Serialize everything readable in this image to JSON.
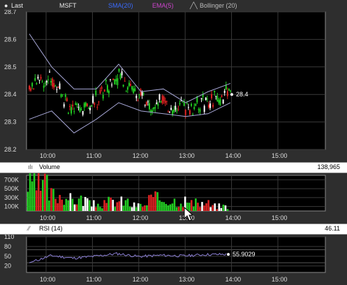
{
  "legend": {
    "last_label": "Last",
    "symbol": "MSFT",
    "sma_label": "SMA(20)",
    "ema_label": "EMA(5)",
    "bollinger_label": "Bollinger (20)"
  },
  "price_panel": {
    "y_ticks": [
      "28.7",
      "28.6",
      "28.5",
      "28.4",
      "28.3",
      "28.2"
    ],
    "last_value": "28.4"
  },
  "volume_panel": {
    "title": "Volume",
    "value": "138,965",
    "y_ticks": [
      "700K",
      "500K",
      "300K",
      "100K"
    ]
  },
  "rsi_panel": {
    "title": "RSI (14)",
    "value": "46.11",
    "y_ticks": [
      "110",
      "80",
      "50",
      "20"
    ],
    "marker_value": "55.9029"
  },
  "time_axis": [
    "10:00",
    "11:00",
    "12:00",
    "13:00",
    "14:00",
    "15:00"
  ],
  "colors": {
    "up": "#22cc22",
    "down": "#dd2222",
    "neutral": "#ffffff",
    "panel_bg": "#000000",
    "frame": "#2e2e2e",
    "band": "#a8a8d8"
  },
  "chart_data": [
    {
      "type": "candlestick",
      "title": "",
      "ylim": [
        28.2,
        28.7
      ],
      "x": [
        "09:30",
        "10:00",
        "10:30",
        "11:00",
        "11:30",
        "12:00",
        "12:30",
        "13:00",
        "13:30",
        "13:50"
      ],
      "close": [
        28.43,
        28.46,
        28.33,
        28.38,
        28.47,
        28.39,
        28.36,
        28.35,
        28.37,
        28.4
      ],
      "bollinger_upper": [
        28.62,
        28.5,
        28.42,
        28.42,
        28.51,
        28.41,
        28.42,
        28.37,
        28.41,
        28.44
      ],
      "bollinger_lower": [
        28.31,
        28.34,
        28.26,
        28.31,
        28.37,
        28.34,
        28.33,
        28.32,
        28.33,
        28.37
      ]
    },
    {
      "type": "bar",
      "title": "Volume",
      "ylim": [
        0,
        800000
      ],
      "values": [
        650000,
        420000,
        300000,
        180000,
        250000,
        150000,
        320000,
        280000,
        200000,
        130000
      ]
    },
    {
      "type": "line",
      "title": "RSI (14)",
      "ylim": [
        0,
        110
      ],
      "values": [
        30,
        52,
        44,
        50,
        58,
        49,
        53,
        51,
        55,
        55.9
      ]
    }
  ]
}
